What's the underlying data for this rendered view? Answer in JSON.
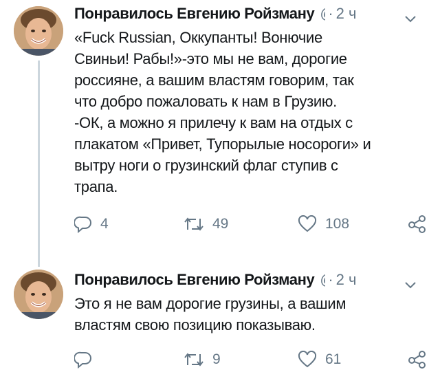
{
  "tweets": [
    {
      "author_name": "Понравилось Евгению Ройзману",
      "handle": "@",
      "separator": "·",
      "time": "2 ч",
      "text": "«Fuck Russian, Оккупанты! Вонючие\nСвиньи! Рабы!»-это мы не вам, дорогие\nроссияне, а вашим властям говорим, так\nчто добро пожаловать к нам в Грузию.\n-ОК, а можно я прилечу к вам на отдых с\nплакатом «Привет, Тупорылые носороги» и\nвытру ноги о грузинский флаг ступив с\nтрапа.",
      "replies": "4",
      "retweets": "49",
      "likes": "108"
    },
    {
      "author_name": "Понравилось Евгению Ройзману",
      "handle": "@",
      "separator": "·",
      "time": "2 ч",
      "text": "Это я не вам дорогие грузины, а вашим\nвластям свою позицию показываю.",
      "replies": "",
      "retweets": "9",
      "likes": "61"
    }
  ],
  "colors": {
    "text": "#14171a",
    "muted": "#657786",
    "thread_line": "#ccd6dd",
    "background": "#ffffff"
  },
  "icons": {
    "reply": "reply-icon",
    "retweet": "retweet-icon",
    "like": "heart-icon",
    "share": "share-icon",
    "menu": "chevron-down-icon"
  }
}
